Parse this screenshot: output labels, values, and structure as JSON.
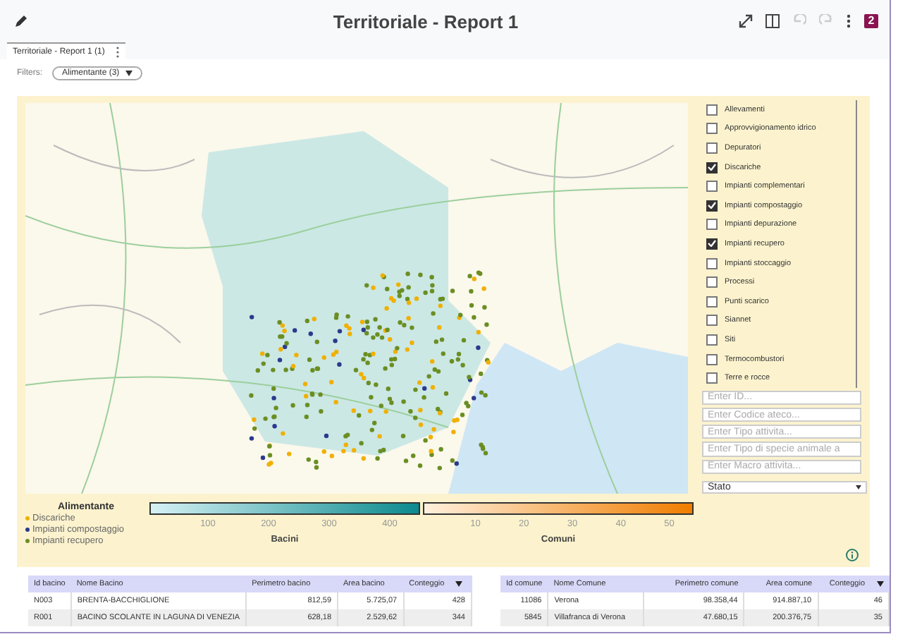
{
  "header": {
    "title": "Territoriale - Report 1",
    "badge": "2",
    "undo_disabled": true,
    "redo_disabled": true
  },
  "page_tab": {
    "label": "Territoriale - Report 1 (1)",
    "selected": true
  },
  "filters": {
    "label": "Filters:",
    "chips": [
      {
        "label": "Alimentante (3)"
      }
    ]
  },
  "layers": [
    {
      "label": "Allevamenti",
      "checked": false
    },
    {
      "label": "Approvvigionamento idrico",
      "checked": false
    },
    {
      "label": "Depuratori",
      "checked": false
    },
    {
      "label": "Discariche",
      "checked": true
    },
    {
      "label": "Impianti complementari",
      "checked": false
    },
    {
      "label": "Impianti compostaggio",
      "checked": true
    },
    {
      "label": "Impianti depurazione",
      "checked": false
    },
    {
      "label": "Impianti recupero",
      "checked": true
    },
    {
      "label": "Impianti stoccaggio",
      "checked": false
    },
    {
      "label": "Processi",
      "checked": false
    },
    {
      "label": "Punti scarico",
      "checked": false
    },
    {
      "label": "Siannet",
      "checked": false
    },
    {
      "label": "Siti",
      "checked": false
    },
    {
      "label": "Termocombustori",
      "checked": false
    },
    {
      "label": "Terre e rocce",
      "checked": false
    }
  ],
  "search_fields": [
    {
      "placeholder": "Enter ID..."
    },
    {
      "placeholder": "Enter Codice ateco..."
    },
    {
      "placeholder": "Enter Tipo attivita..."
    },
    {
      "placeholder": "Enter Tipo di specie animale a"
    },
    {
      "placeholder": "Enter Macro attivita..."
    }
  ],
  "state_select": {
    "value": "Stato"
  },
  "legend": {
    "title": "Alimentante",
    "items": [
      {
        "label": "Discariche",
        "color": "#f0b000"
      },
      {
        "label": "Impianti compostaggio",
        "color": "#2b3a8c"
      },
      {
        "label": "Impianti recupero",
        "color": "#6b8e23"
      }
    ]
  },
  "scales": [
    {
      "title": "Bacini",
      "kind": "teal",
      "ticks": [
        "100",
        "200",
        "300",
        "400"
      ]
    },
    {
      "title": "Comuni",
      "kind": "orange",
      "ticks": [
        "10",
        "20",
        "30",
        "40",
        "50"
      ]
    }
  ],
  "tables": [
    {
      "columns": [
        "Id bacino",
        "Nome Bacino",
        "Perimetro bacino",
        "Area bacino",
        "Conteggio"
      ],
      "rows": [
        [
          "N003",
          "BRENTA-BACCHIGLIONE",
          "812,59",
          "5.725,07",
          "428"
        ],
        [
          "R001",
          "BACINO SCOLANTE IN LAGUNA DI VENEZIA",
          "628,18",
          "2.529,62",
          "344"
        ]
      ]
    },
    {
      "columns": [
        "Id comune",
        "Nome Comune",
        "Perimetro comune",
        "Area comune",
        "Conteggio"
      ],
      "rows": [
        [
          "11086",
          "Verona",
          "98.358,44",
          "914.887,10",
          "46"
        ],
        [
          "5845",
          "Villafranca di Verona",
          "47.680,15",
          "200.376,75",
          "35"
        ]
      ]
    }
  ]
}
